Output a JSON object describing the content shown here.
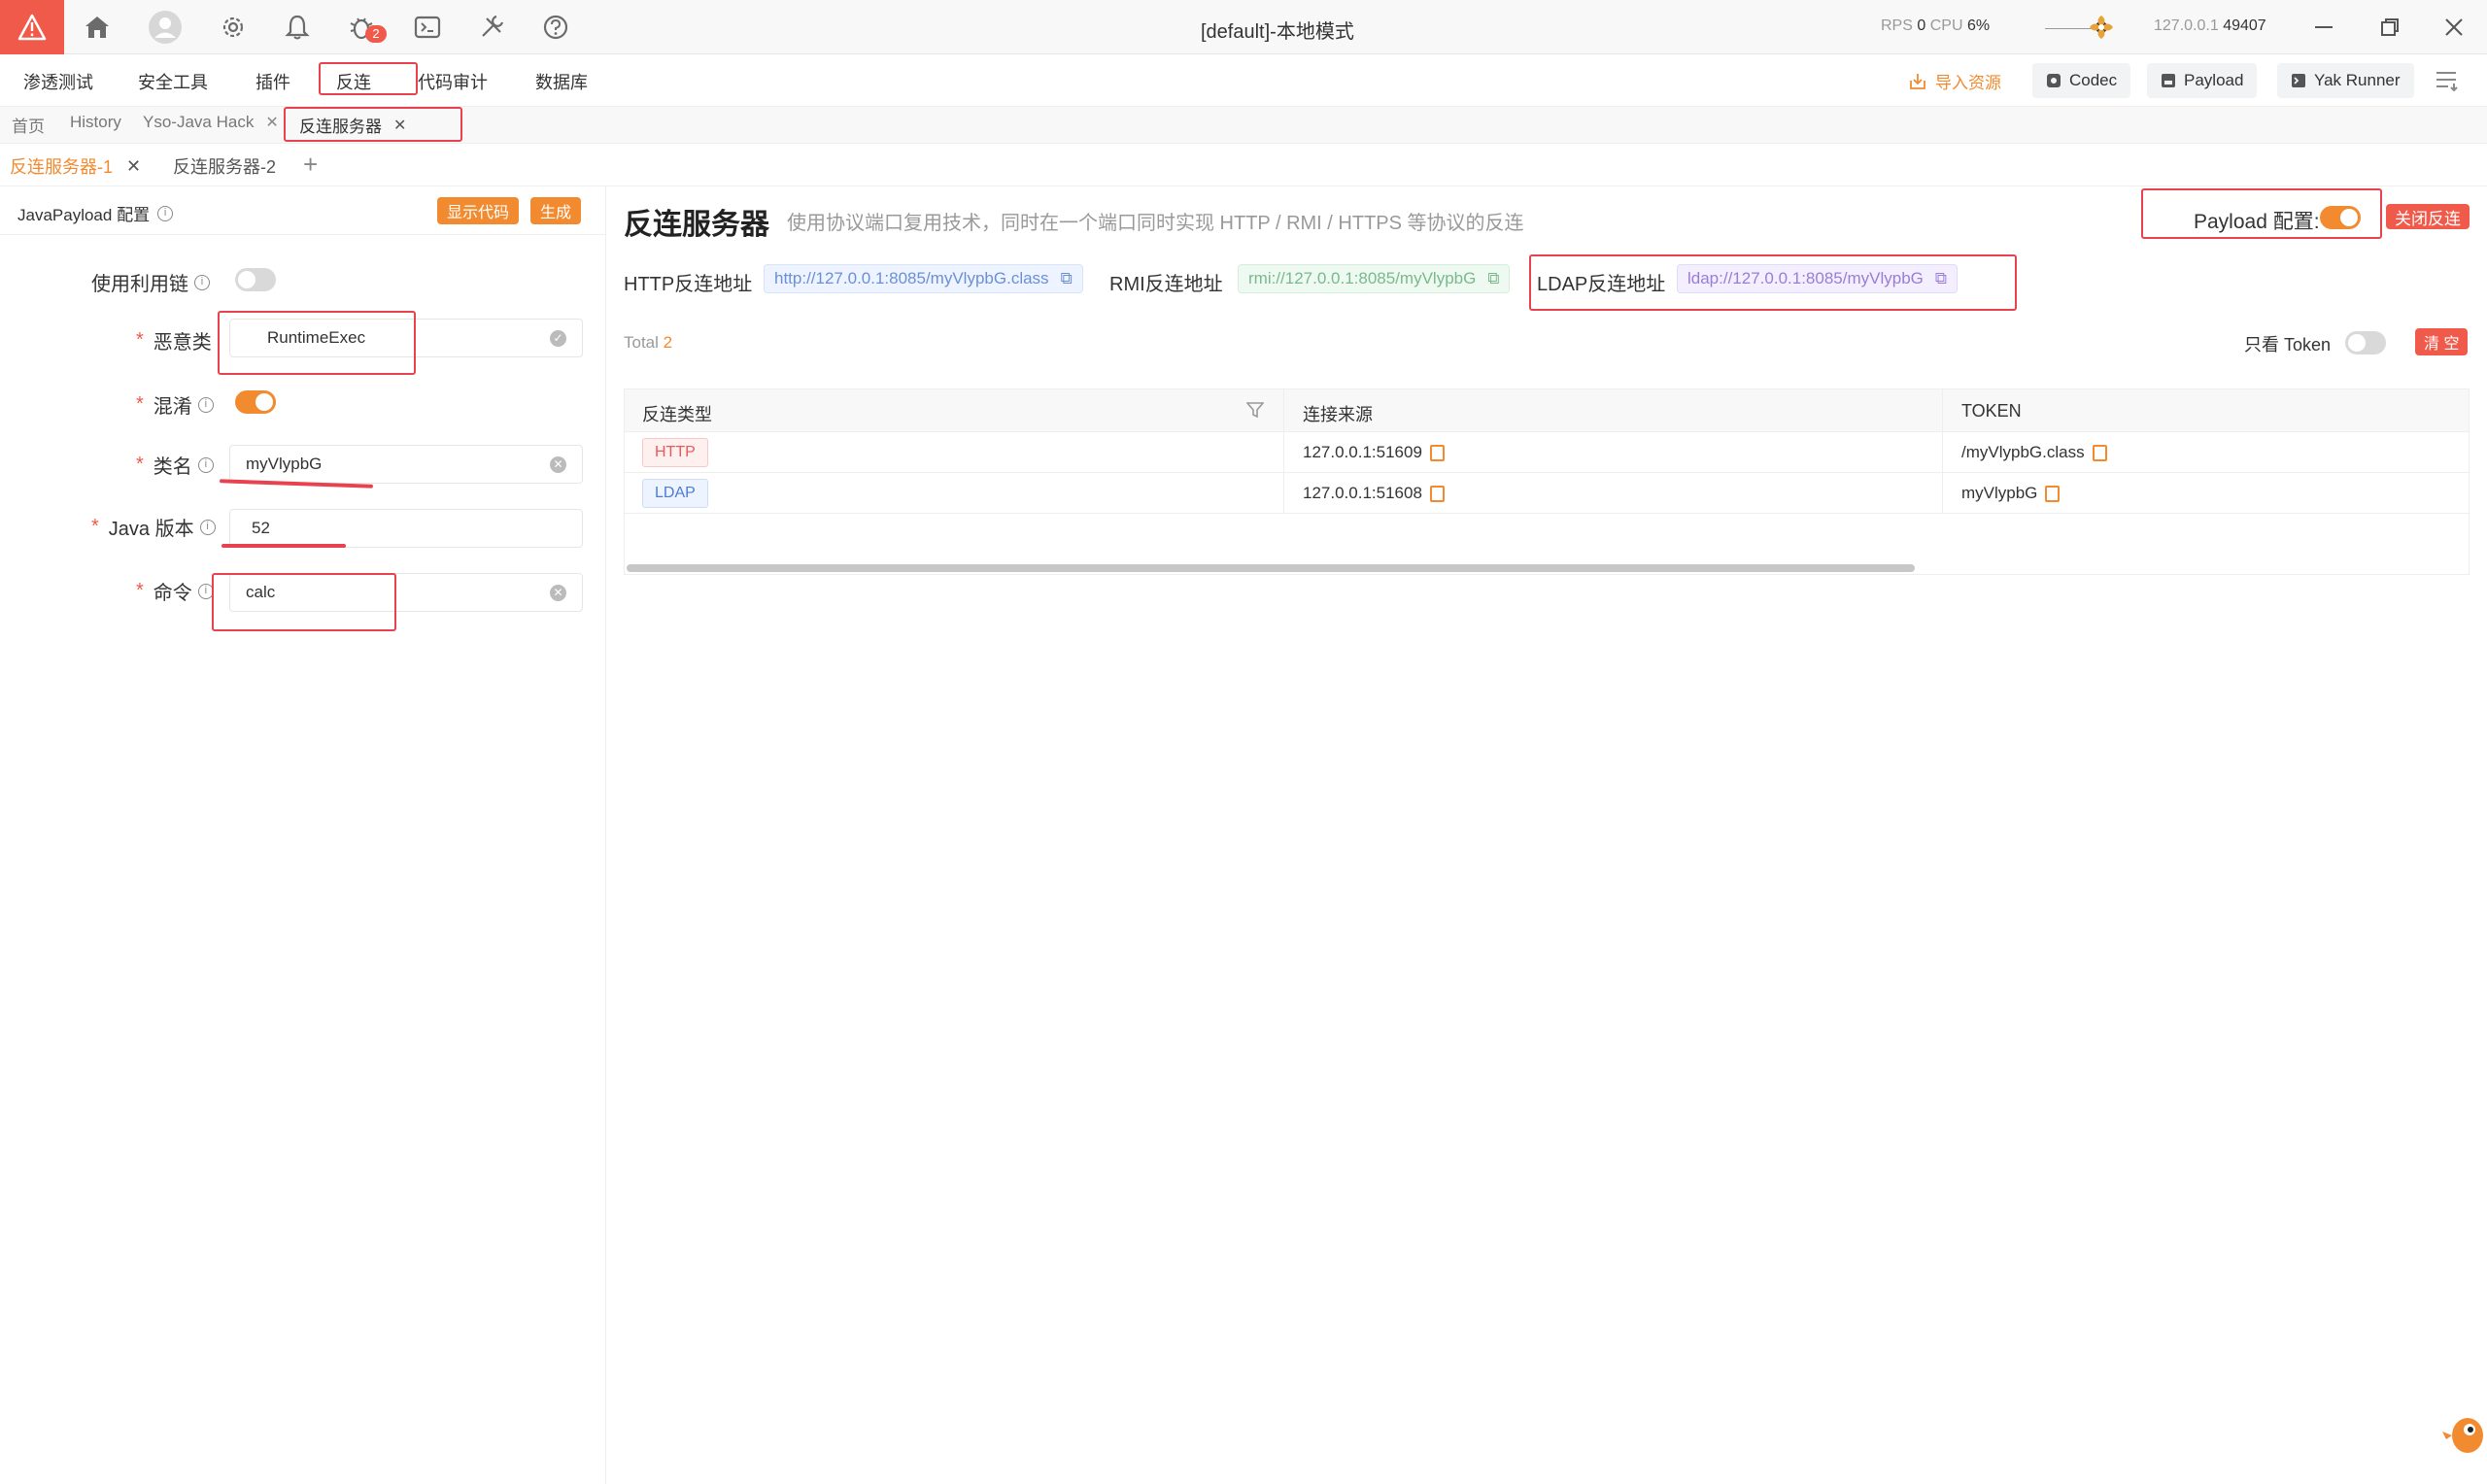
{
  "titlebar": {
    "title": "[default]-本地模式",
    "rps_label": "RPS",
    "rps_value": "0",
    "cpu_label": "CPU",
    "cpu_value": "6%",
    "ip": "127.0.0.1",
    "port": "49407",
    "bug_badge": "2"
  },
  "menu": {
    "items": [
      "渗透测试",
      "安全工具",
      "插件",
      "反连",
      "代码审计",
      "数据库"
    ],
    "import_label": "导入资源",
    "codec_label": "Codec",
    "payload_label": "Payload",
    "yak_runner_label": "Yak Runner"
  },
  "page_tabs": [
    "首页",
    "History",
    "Yso-Java Hack",
    "反连服务器"
  ],
  "sub_tabs": [
    "反连服务器-1",
    "反连服务器-2"
  ],
  "left": {
    "title": "JavaPayload 配置",
    "show_code": "显示代码",
    "generate": "生成",
    "use_chain_label": "使用利用链",
    "use_chain_on": false,
    "malicious_class_label": "恶意类",
    "malicious_class_value": "RuntimeExec",
    "obfuscate_label": "混淆",
    "obfuscate_on": true,
    "class_name_label": "类名",
    "class_name_value": "myVlypbG",
    "java_version_label": "Java 版本",
    "java_version_value": "52",
    "command_label": "命令",
    "command_value": "calc"
  },
  "main": {
    "title": "反连服务器",
    "description": "使用协议端口复用技术，同时在一个端口同时实现 HTTP / RMI / HTTPS 等协议的反连",
    "payload_config_label": "Payload 配置:",
    "payload_config_on": true,
    "close_reverse": "关闭反连",
    "http_label": "HTTP反连地址",
    "http_addr": "http://127.0.0.1:8085/myVlypbG.class",
    "rmi_label": "RMI反连地址",
    "rmi_addr": "rmi://127.0.0.1:8085/myVlypbG",
    "ldap_label": "LDAP反连地址",
    "ldap_addr": "ldap://127.0.0.1:8085/myVlypbG",
    "total_label": "Total",
    "total_value": "2",
    "only_token_label": "只看 Token",
    "only_token_on": false,
    "clear_label": "清 空"
  },
  "table": {
    "headers": [
      "反连类型",
      "连接来源",
      "TOKEN"
    ],
    "rows": [
      {
        "type": "HTTP",
        "source": "127.0.0.1:51609",
        "token": "/myVlypbG.class"
      },
      {
        "type": "LDAP",
        "source": "127.0.0.1:51608",
        "token": "myVlypbG"
      }
    ]
  },
  "colors": {
    "accent": "#f28b30",
    "danger": "#f05a4a",
    "annotation": "#e8424f"
  }
}
